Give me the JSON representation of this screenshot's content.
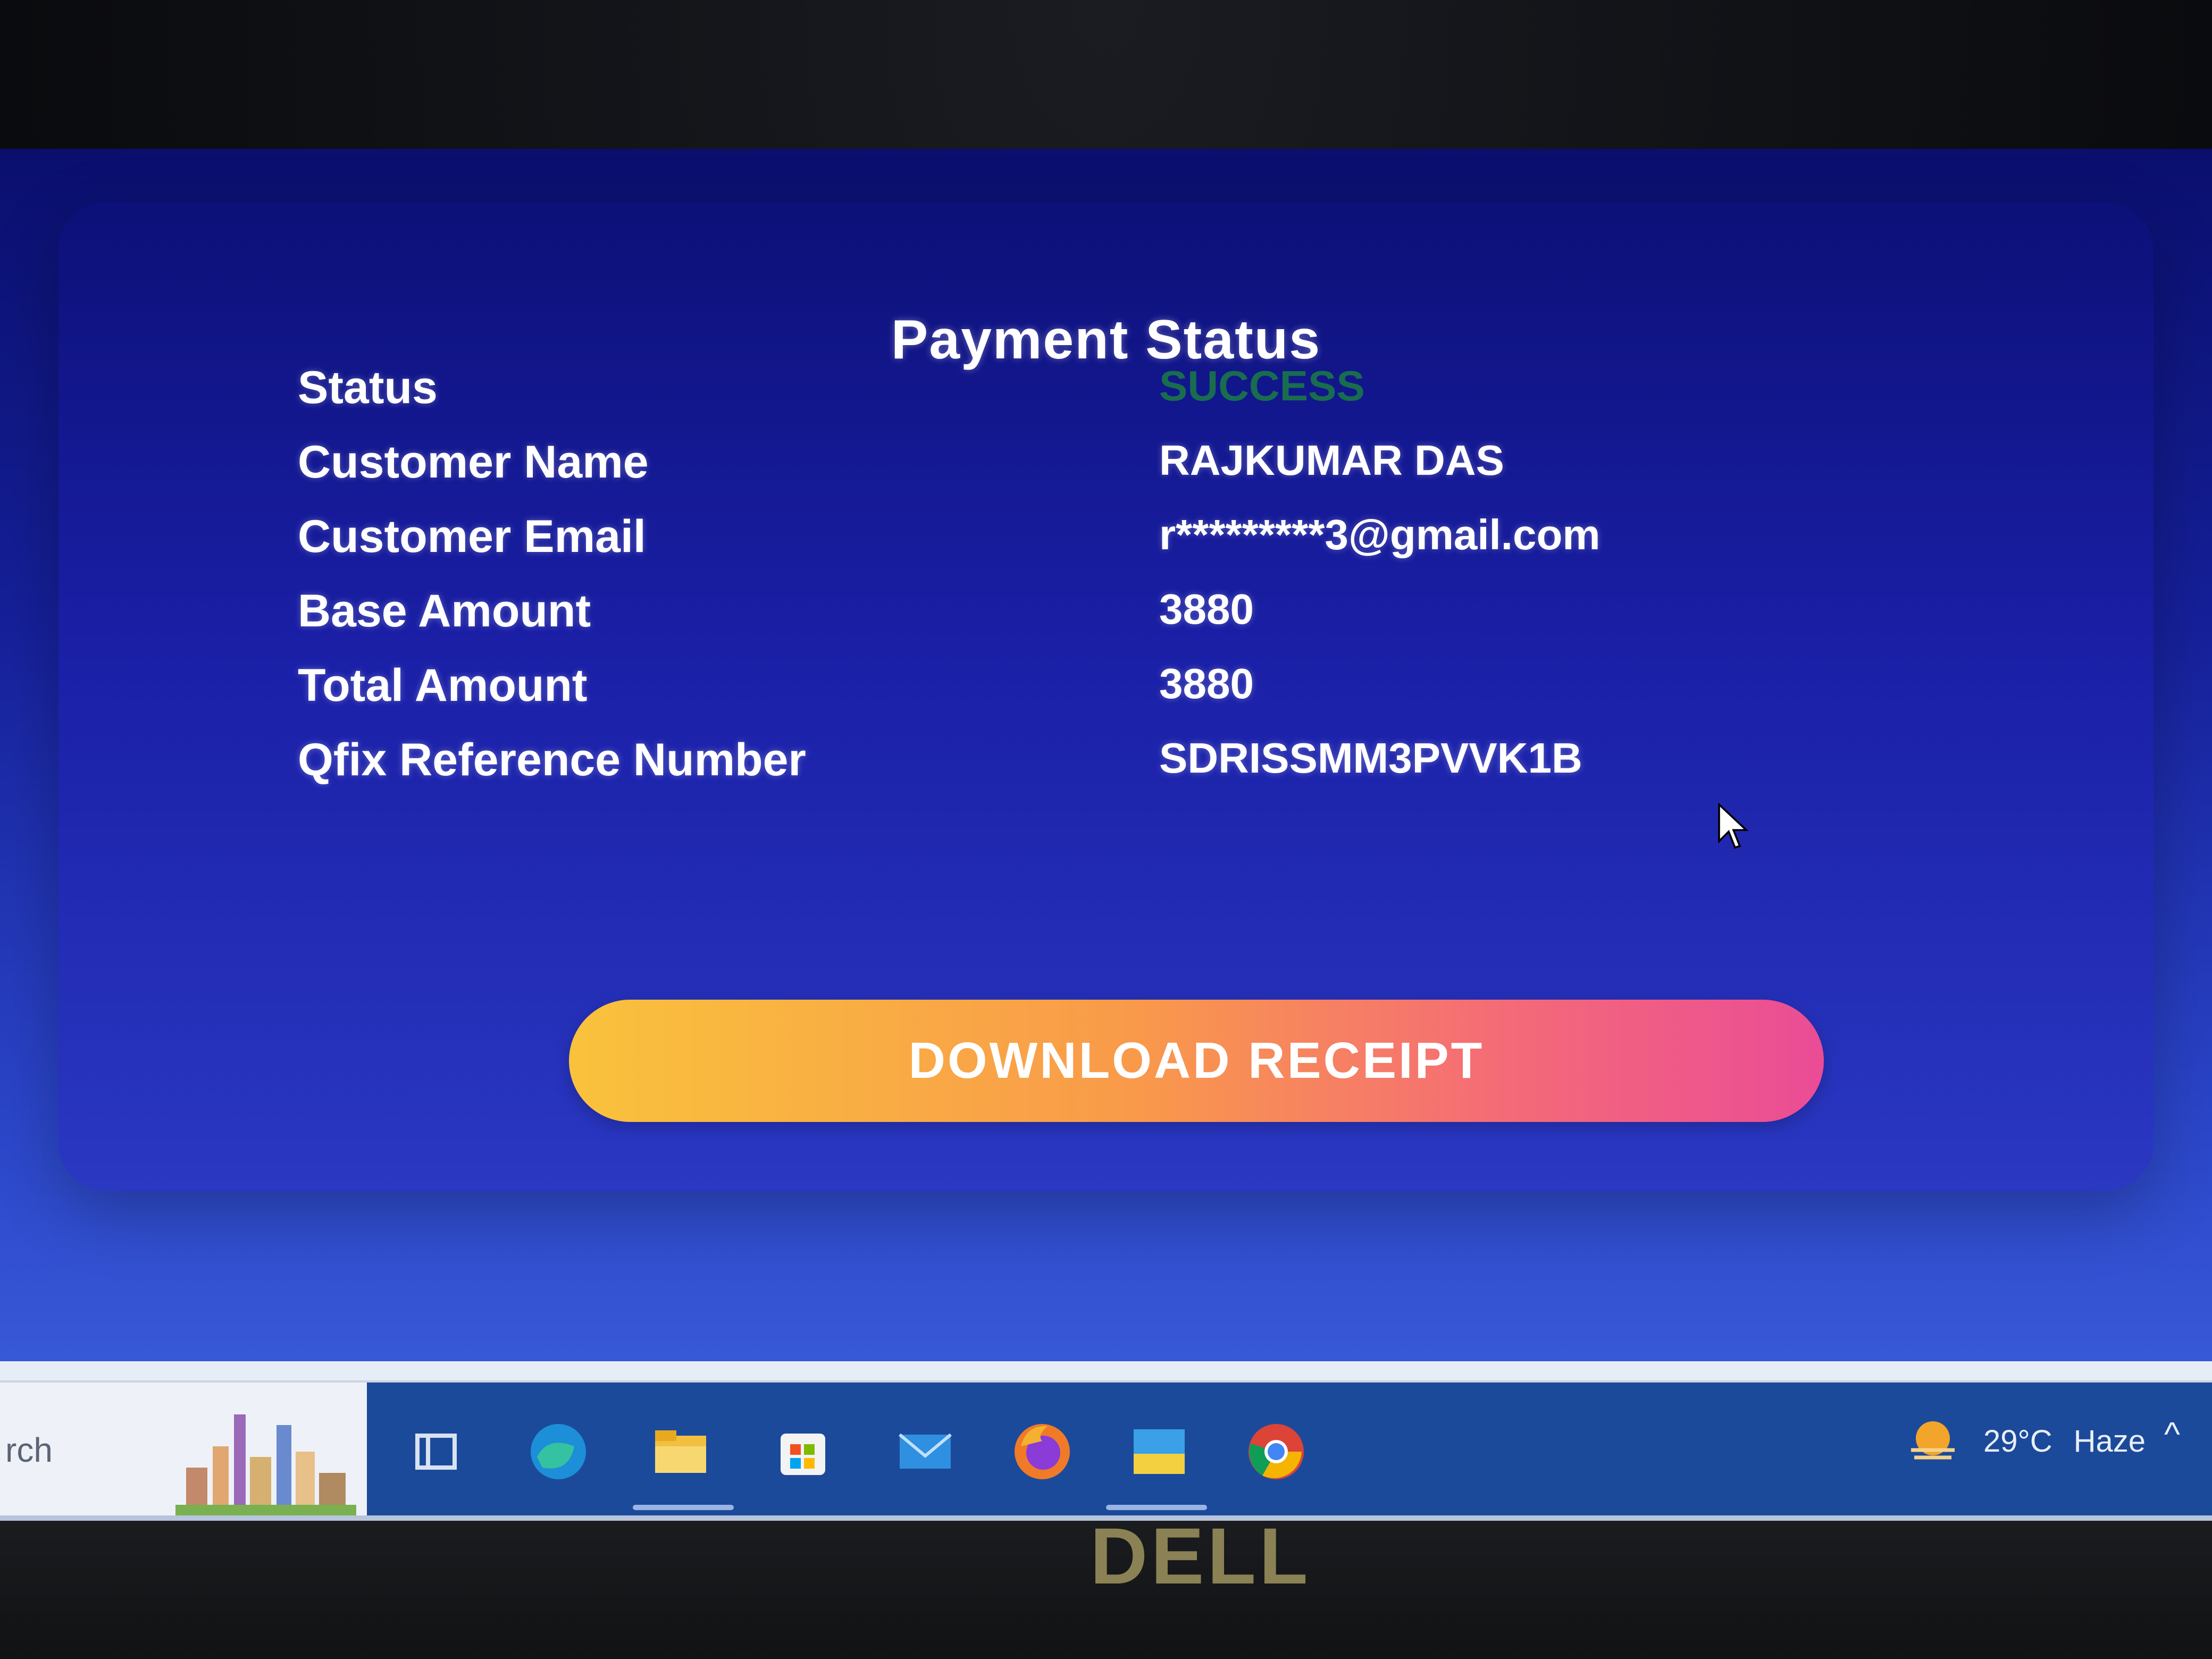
{
  "page": {
    "title": "Payment Status"
  },
  "details": [
    {
      "label": "Status",
      "value": "SUCCESS"
    },
    {
      "label": "Customer Name",
      "value": "RAJKUMAR DAS"
    },
    {
      "label": "Customer Email",
      "value": "r*********3@gmail.com"
    },
    {
      "label": "Base Amount",
      "value": "3880"
    },
    {
      "label": "Total Amount",
      "value": "3880"
    },
    {
      "label": "Qfix Reference Number",
      "value": "SDRISSMM3PVVK1B"
    }
  ],
  "actions": {
    "download_label": "DOWNLOAD RECEIPT"
  },
  "taskbar": {
    "search_text": "rch",
    "icons": [
      "task-view-icon",
      "edge-icon",
      "file-explorer-icon",
      "store-icon",
      "mail-icon",
      "firefox-icon",
      "photos-icon",
      "chrome-icon"
    ],
    "active_app": "chrome-icon",
    "weather_temp": "29°C",
    "weather_desc": "Haze",
    "tray_chevron": "^"
  },
  "monitor": {
    "brand": "DELL"
  },
  "colors": {
    "background_top": "#0a0f6e",
    "background_bottom": "#3f64e0",
    "success": "#1a8a3a",
    "button_gradient_start": "#f9c23c",
    "button_gradient_end": "#ea4c96"
  }
}
